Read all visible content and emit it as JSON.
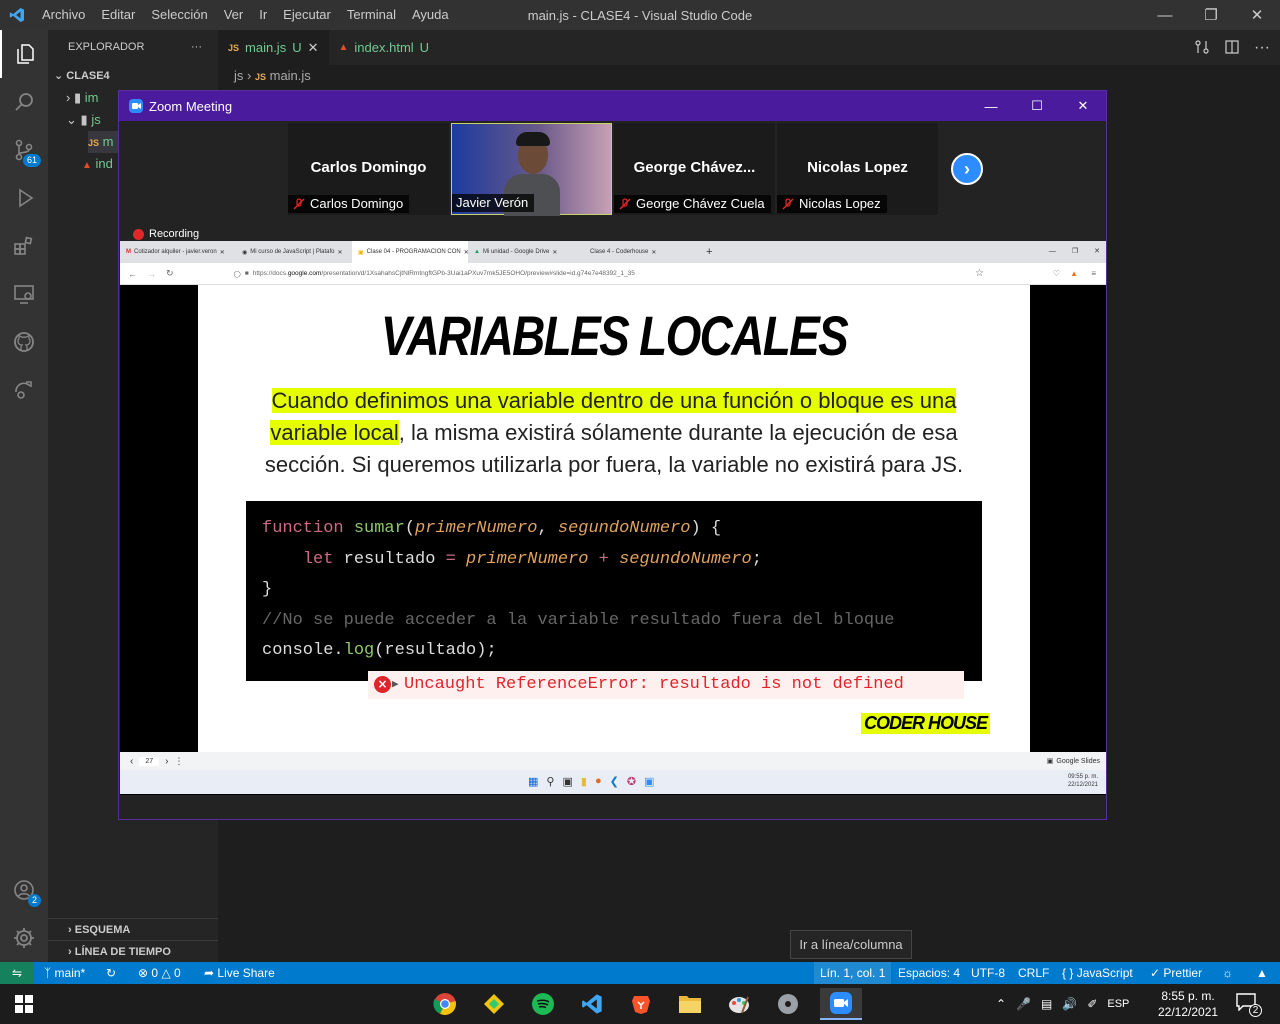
{
  "vscode": {
    "menu": [
      "Archivo",
      "Editar",
      "Selección",
      "Ver",
      "Ir",
      "Ejecutar",
      "Terminal",
      "Ayuda"
    ],
    "window_title": "main.js - CLASE4 - Visual Studio Code",
    "explorer_label": "EXPLORADOR",
    "explorer_more": "···",
    "folder": "CLASE4",
    "tree": [
      "im",
      "js",
      "m",
      "ind"
    ],
    "tabs": [
      {
        "name": "main.js",
        "status": "U"
      },
      {
        "name": "index.html",
        "status": "U"
      }
    ],
    "breadcrumb": {
      "folder": "js",
      "file": "main.js"
    },
    "scm_badge": "61",
    "accounts_badge": "2",
    "outline_label": "ESQUEMA",
    "timeline_label": "LÍNEA DE TIEMPO",
    "tooltip": "Ir a línea/columna"
  },
  "status_bar": {
    "branch": "main*",
    "errors": "0",
    "warnings": "0",
    "live_share": "Live Share",
    "position": "Lín. 1, col. 1",
    "spaces": "Espacios: 4",
    "encoding": "UTF-8",
    "eol": "CRLF",
    "language": "JavaScript",
    "prettier": "Prettier"
  },
  "zoom": {
    "title": "Zoom Meeting",
    "participants": [
      {
        "display": "Carlos Domingo",
        "label": "Carlos Domingo",
        "muted": true
      },
      {
        "display": "",
        "label": "Javier Verón",
        "muted": false
      },
      {
        "display": "George  Chávez...",
        "label": "George Chávez Cuela",
        "muted": true
      },
      {
        "display": "Nicolas Lopez",
        "label": "Nicolas Lopez",
        "muted": true
      }
    ],
    "recording": "Recording"
  },
  "browser": {
    "tabs": [
      "Cotizador alquiler - javier.veron",
      "Mi curso de JavaScript | Platafo",
      "Clase 04 - PROGRAMACION CON",
      "Mi unidad - Google Drive",
      "Clase 4 - Coderhouse"
    ],
    "url_prefix": "https://docs.",
    "url_host": "google.com",
    "url_path": "/presentation/d/1XsahahsCjtNlRmtngftGPb-3Uai1aPXuv7mk5JE5OHO/preview#slide=id.g74e7e48392_1_35",
    "page_number": "27",
    "slides_label": "Google Slides",
    "inner_time": "09:55 p. m.",
    "inner_date": "22/12/2021"
  },
  "slide": {
    "title": "VARIABLES LOCALES",
    "text_highlight_1": "Cuando definimos una variable dentro de una función o bloque es una",
    "text_highlight_2": "variable local",
    "text_rest_1": ", la misma existirá sólamente durante la ejecución de esa",
    "text_rest_2": "sección. Si queremos utilizarla por fuera, la variable no existirá para JS.",
    "code": {
      "l1_kw": "function",
      "l1_fn": "sumar",
      "l1_open": "(",
      "l1_p1": "primerNumero",
      "l1_sep": ", ",
      "l1_p2": "segundoNumero",
      "l1_close": ") {",
      "l2_indent": "    ",
      "l2_kw": "let",
      "l2_var": " resultado ",
      "l2_eq": "=",
      "l2_p1": "primerNumero",
      "l2_plus": " + ",
      "l2_p2": "segundoNumero",
      "l2_end": ";",
      "l3": "}",
      "l4": "//No se puede acceder a la variable resultado fuera del bloque",
      "l5_obj": "console",
      "l5_dot": ".",
      "l5_fn": "log",
      "l5_args": "(resultado);"
    },
    "error": "Uncaught ReferenceError: resultado is not defined",
    "brand": "CODER HOUSE"
  },
  "taskbar": {
    "lang": "ESP",
    "time": "8:55 p. m.",
    "date": "22/12/2021",
    "notifications": "2"
  }
}
